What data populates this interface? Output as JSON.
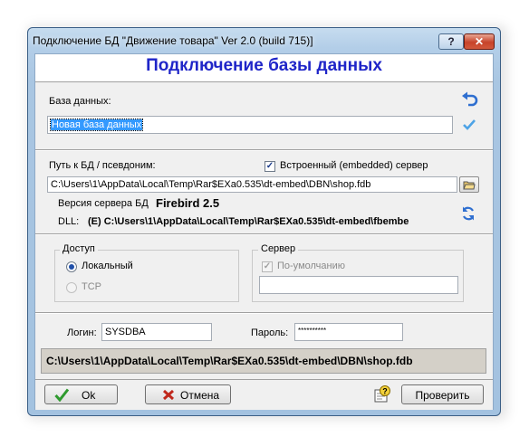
{
  "window": {
    "title": "Подключение БД \"Движение товара\" Ver 2.0 (build 715)]",
    "help_label": "?",
    "close_label": "✕"
  },
  "header": {
    "title": "Подключение базы данных"
  },
  "database": {
    "label": "База данных:",
    "value": "Новая база данных"
  },
  "path": {
    "label": "Путь к БД / псевдоним:",
    "embedded_label": "Встроенный (embedded) сервер",
    "embedded_checked": true,
    "value": "C:\\Users\\1\\AppData\\Local\\Temp\\Rar$EXa0.535\\dt-embed\\DBN\\shop.fdb"
  },
  "server_version": {
    "label": "Версия сервера БД",
    "value": "Firebird 2.5"
  },
  "dll": {
    "label": "DLL:",
    "value": "(E) C:\\Users\\1\\AppData\\Local\\Temp\\Rar$EXa0.535\\dt-embed\\fbembe"
  },
  "access": {
    "group_label": "Доступ",
    "local_label": "Локальный",
    "tcp_label": "TCP",
    "selected": "Локальный"
  },
  "server": {
    "group_label": "Сервер",
    "default_label": "По-умолчанию",
    "default_checked": true,
    "address_value": ""
  },
  "login": {
    "label": "Логин:",
    "value": "SYSDBA"
  },
  "password": {
    "label": "Пароль:",
    "value": "**********"
  },
  "status": {
    "text": "C:\\Users\\1\\AppData\\Local\\Temp\\Rar$EXa0.535\\dt-embed\\DBN\\shop.fdb"
  },
  "buttons": {
    "ok": "Ok",
    "cancel": "Отмена",
    "check": "Проверить"
  },
  "icons": {
    "undo": "undo-arrow-icon",
    "accept": "checkmark-icon",
    "browse": "open-folder-icon",
    "refresh": "refresh-icon",
    "ok": "green-check-icon",
    "cancel": "red-x-icon",
    "help": "help-question-icon"
  },
  "colors": {
    "header_title": "#1f25c8",
    "accent_blue": "#2f6fd0",
    "ok_green": "#2e9a2e",
    "cancel_red": "#c0281c"
  }
}
